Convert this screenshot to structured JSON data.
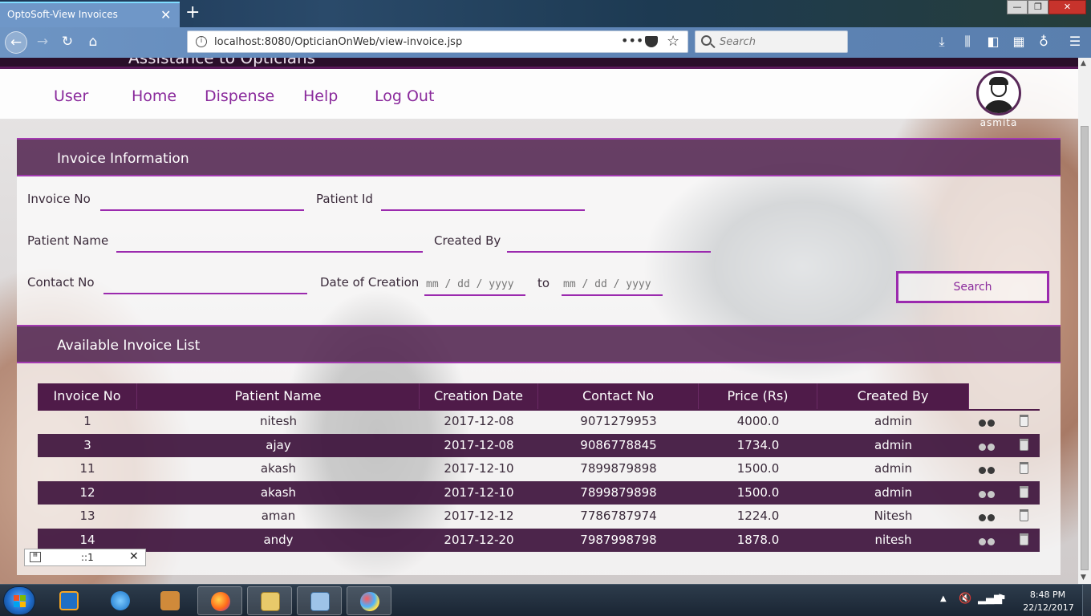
{
  "browser": {
    "tab_title": "OptoSoft-View Invoices",
    "tab_close": "✕",
    "new_tab": "+",
    "url": "localhost:8080/OpticianOnWeb/view-invoice.jsp",
    "search_placeholder": "Search",
    "window_min": "—",
    "window_max": "❐",
    "window_close": "✕"
  },
  "site": {
    "subtitle": "Assistance to Opticians",
    "menu": [
      "User",
      "Home",
      "Dispense",
      "Help",
      "Log Out"
    ],
    "username": "asmita"
  },
  "invoice_info": {
    "title": "Invoice Information",
    "labels": {
      "invoice_no": "Invoice No",
      "patient_id": "Patient Id",
      "patient_name": "Patient Name",
      "created_by": "Created By",
      "contact_no": "Contact No",
      "date_of_creation": "Date of Creation",
      "to": "to"
    },
    "date_placeholder": "mm / dd / yyyy",
    "search_button": "Search"
  },
  "invoice_list": {
    "title": "Available Invoice List",
    "columns": [
      "Invoice No",
      "Patient Name",
      "Creation Date",
      "Contact No",
      "Price (Rs)",
      "Created By"
    ],
    "rows": [
      [
        "1",
        "nitesh",
        "2017-12-08",
        "9071279953",
        "4000.0",
        "admin"
      ],
      [
        "3",
        "ajay",
        "2017-12-08",
        "9086778845",
        "1734.0",
        "admin"
      ],
      [
        "11",
        "akash",
        "2017-12-10",
        "7899879898",
        "1500.0",
        "admin"
      ],
      [
        "12",
        "akash",
        "2017-12-10",
        "7899879898",
        "1500.0",
        "admin"
      ],
      [
        "13",
        "aman",
        "2017-12-12",
        "7786787974",
        "1224.0",
        "Nitesh"
      ],
      [
        "14",
        "andy",
        "2017-12-20",
        "7987998798",
        "1878.0",
        "nitesh"
      ]
    ]
  },
  "mini_widget": {
    "text": "::1",
    "close": "✕"
  },
  "taskbar": {
    "time": "8:48 PM",
    "date": "22/12/2017"
  },
  "colors": {
    "accent": "#9b2aae",
    "header_bg": "#522450",
    "row_dark": "#3a0e38"
  }
}
